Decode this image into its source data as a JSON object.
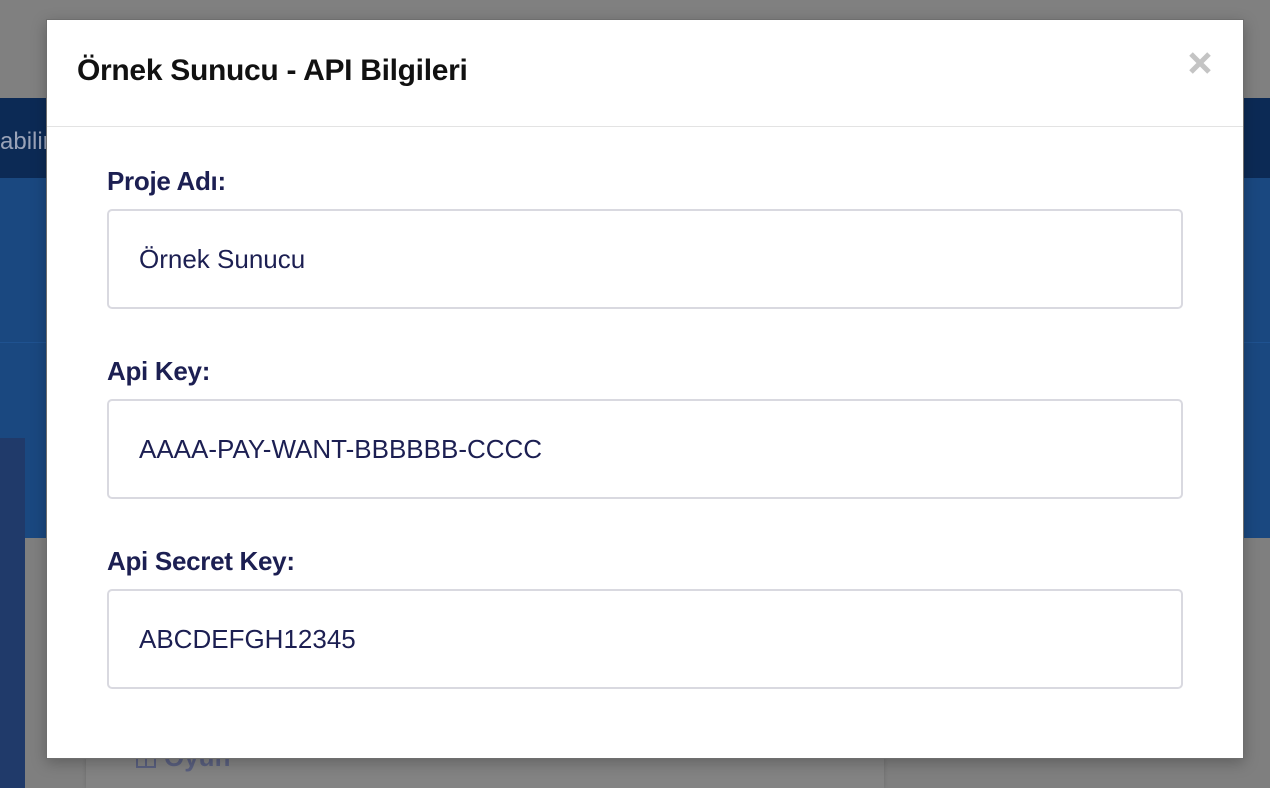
{
  "background": {
    "navbar_partial_text": "abilir",
    "card_label": "Oyun"
  },
  "modal": {
    "title": "Örnek Sunucu - API Bilgileri",
    "close_symbol": "×",
    "fields": [
      {
        "label": "Proje Adı:",
        "value": "Örnek Sunucu"
      },
      {
        "label": "Api Key:",
        "value": "AAAA-PAY-WANT-BBBBBB-CCCC"
      },
      {
        "label": "Api Secret Key:",
        "value": "ABCDEFGH12345"
      }
    ]
  },
  "icons": {
    "close": "close-icon",
    "card": "grid-icon"
  },
  "colors": {
    "label_text": "#1c1f52",
    "title_text": "#111111",
    "input_border": "#d9d9e0",
    "navbar": "#0c2a55",
    "hero": "#1a4880",
    "overlay": "#808080"
  }
}
